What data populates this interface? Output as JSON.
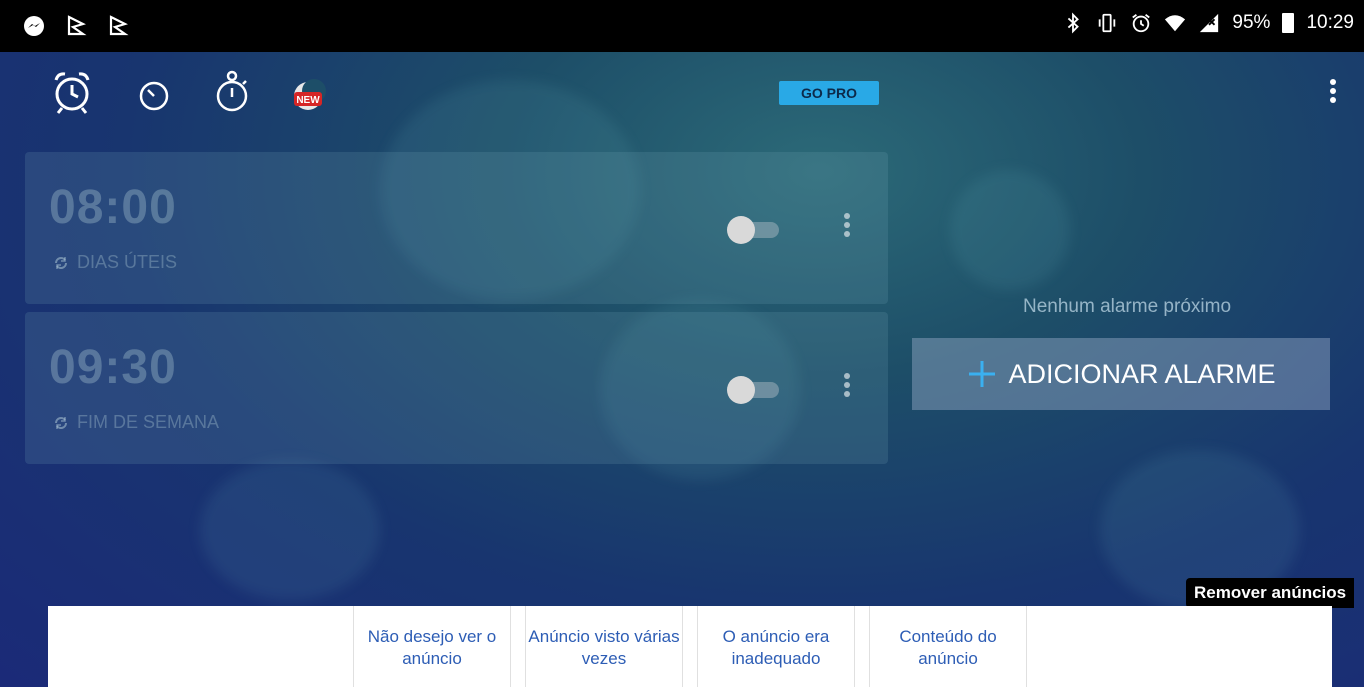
{
  "status_bar": {
    "left_icons": [
      "messenger-icon",
      "flag-icon",
      "flag-icon"
    ],
    "right_icons": [
      "bluetooth-icon",
      "vibrate-icon",
      "alarm-icon",
      "wifi-icon",
      "signal-icon"
    ],
    "battery_percent": "95%",
    "time": "10:29"
  },
  "toolbar": {
    "tabs": [
      "alarm-clock-icon",
      "timer-icon",
      "stopwatch-icon",
      "sleep-new-icon"
    ],
    "new_badge": "NEW",
    "go_pro_label": "GO PRO",
    "accent_color": "#29a9e6"
  },
  "alarms": [
    {
      "time": "08:00",
      "repeat": "DIAS ÚTEIS",
      "enabled": false
    },
    {
      "time": "09:30",
      "repeat": "FIM DE SEMANA",
      "enabled": false
    }
  ],
  "side_panel": {
    "no_alarm_text": "Nenhum alarme próximo",
    "add_alarm_label": "ADICIONAR ALARME"
  },
  "ads": {
    "remove_label": "Remover anúncios",
    "options": [
      "Não desejo ver o anúncio",
      "Anúncio visto várias vezes",
      "O anúncio era inadequado",
      "Conteúdo do anúncio"
    ]
  }
}
